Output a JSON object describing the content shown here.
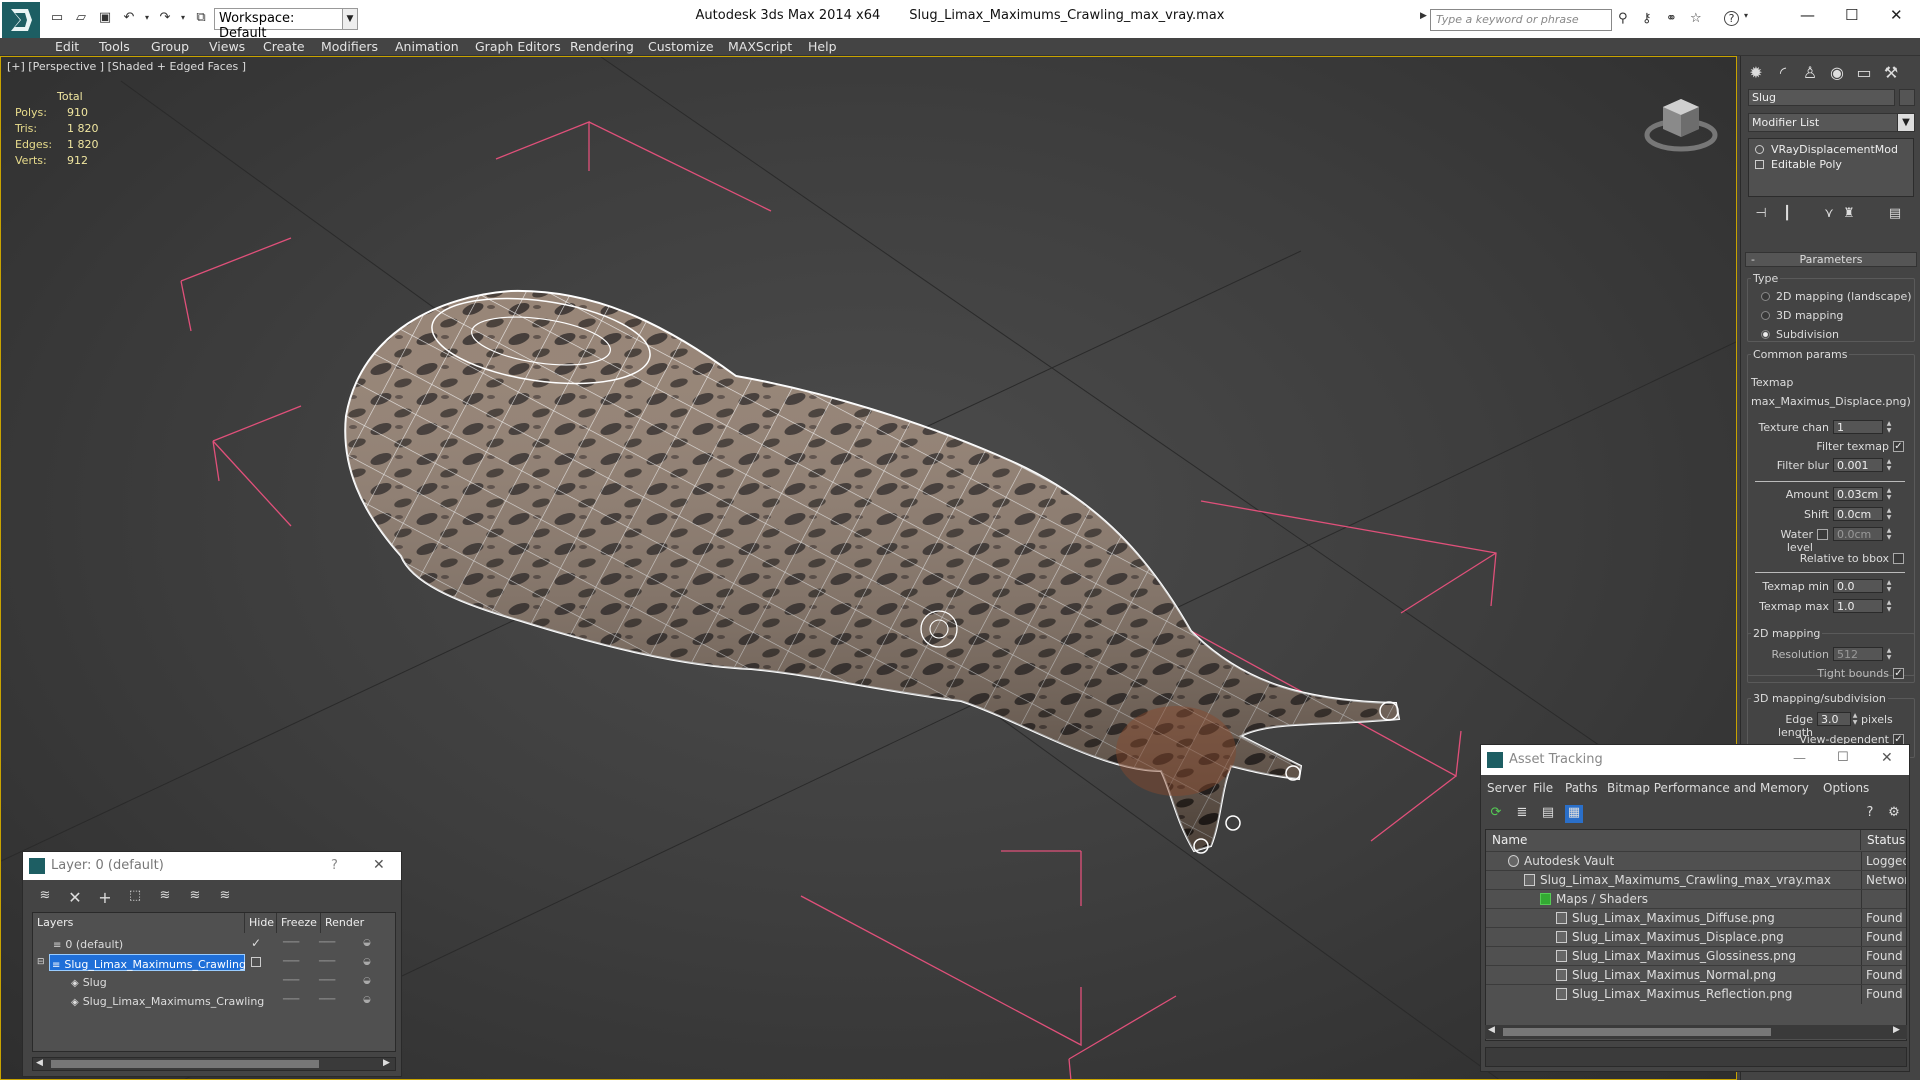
{
  "window": {
    "app_title": "Autodesk 3ds Max  2014 x64",
    "file_title": "Slug_Limax_Maximums_Crawling_max_vray.max",
    "workspace_value": "Workspace: Default",
    "search_placeholder": "Type a keyword or phrase",
    "help_label": "?"
  },
  "menu": {
    "items": [
      "Edit",
      "Tools",
      "Group",
      "Views",
      "Create",
      "Modifiers",
      "Animation",
      "Graph Editors",
      "Rendering",
      "Customize",
      "MAXScript",
      "Help"
    ]
  },
  "viewport": {
    "label": "[+] [Perspective ] [Shaded + Edged Faces ]",
    "stats": {
      "header": "Total",
      "rows": [
        {
          "label": "Polys:",
          "value": "910"
        },
        {
          "label": "Tris:",
          "value": "1 820"
        },
        {
          "label": "Edges:",
          "value": "1 820"
        },
        {
          "label": "Verts:",
          "value": "912"
        }
      ]
    }
  },
  "command_panel": {
    "object_name": "Slug",
    "modifier_list": "Modifier List",
    "stack": [
      "VRayDisplacementMod",
      "Editable Poly"
    ],
    "rollout_title": "Parameters",
    "minus": "-",
    "type_label": "Type",
    "type_options": [
      "2D mapping (landscape)",
      "3D mapping",
      "Subdivision"
    ],
    "common_params": "Common params",
    "texmap_label": "Texmap",
    "texmap_value": "max_Maximus_Displace.png)",
    "texture_chan_label": "Texture chan",
    "texture_chan": "1",
    "filter_texmap_label": "Filter texmap",
    "filter_blur_label": "Filter blur",
    "filter_blur": "0.001",
    "amount_label": "Amount",
    "amount": "0.03cm",
    "shift_label": "Shift",
    "shift": "0.0cm",
    "water_level_label": "Water level",
    "water_level": "0.0cm",
    "relative_bbox_label": "Relative to bbox",
    "texmap_min_label": "Texmap min",
    "texmap_min": "0.0",
    "texmap_max_label": "Texmap max",
    "texmap_max": "1.0",
    "mapping2d_label": "2D mapping",
    "resolution_label": "Resolution",
    "resolution": "512",
    "tight_bounds_label": "Tight bounds",
    "mapping3d_label": "3D mapping/subdivision",
    "edge_length_label": "Edge length",
    "edge_length": "3.0",
    "pixels_label": "pixels",
    "view_dependent_label": "View-dependent"
  },
  "layer_dialog": {
    "title": "Layer: 0 (default)",
    "help": "?",
    "headers": {
      "layers": "Layers",
      "hide": "Hide",
      "freeze": "Freeze",
      "render": "Render"
    },
    "rows": [
      {
        "name": "0 (default)",
        "indent": 1,
        "current": "✓"
      },
      {
        "name": "Slug_Limax_Maximums_Crawling",
        "indent": 1,
        "selected": true
      },
      {
        "name": "Slug",
        "indent": 2
      },
      {
        "name": "Slug_Limax_Maximums_Crawling",
        "indent": 2
      }
    ]
  },
  "asset_dialog": {
    "title": "Asset Tracking",
    "menu": [
      "Server",
      "File",
      "Paths",
      "Bitmap Performance and Memory",
      "Options"
    ],
    "headers": {
      "name": "Name",
      "status": "Status"
    },
    "rows": [
      {
        "name": "Autodesk Vault",
        "status": "Logged (",
        "indent": 1
      },
      {
        "name": "Slug_Limax_Maximums_Crawling_max_vray.max",
        "status": "Network",
        "indent": 2
      },
      {
        "name": "Maps / Shaders",
        "status": "",
        "indent": 3
      },
      {
        "name": "Slug_Limax_Maximus_Diffuse.png",
        "status": "Found",
        "indent": 4
      },
      {
        "name": "Slug_Limax_Maximus_Displace.png",
        "status": "Found",
        "indent": 4
      },
      {
        "name": "Slug_Limax_Maximus_Glossiness.png",
        "status": "Found",
        "indent": 4
      },
      {
        "name": "Slug_Limax_Maximus_Normal.png",
        "status": "Found",
        "indent": 4
      },
      {
        "name": "Slug_Limax_Maximus_Reflection.png",
        "status": "Found",
        "indent": 4
      }
    ]
  },
  "colors": {
    "accent": "#c8a300",
    "selection": "#1f6fd8",
    "bounding_box": "#e0507a",
    "wireframe": "#ffffff"
  }
}
